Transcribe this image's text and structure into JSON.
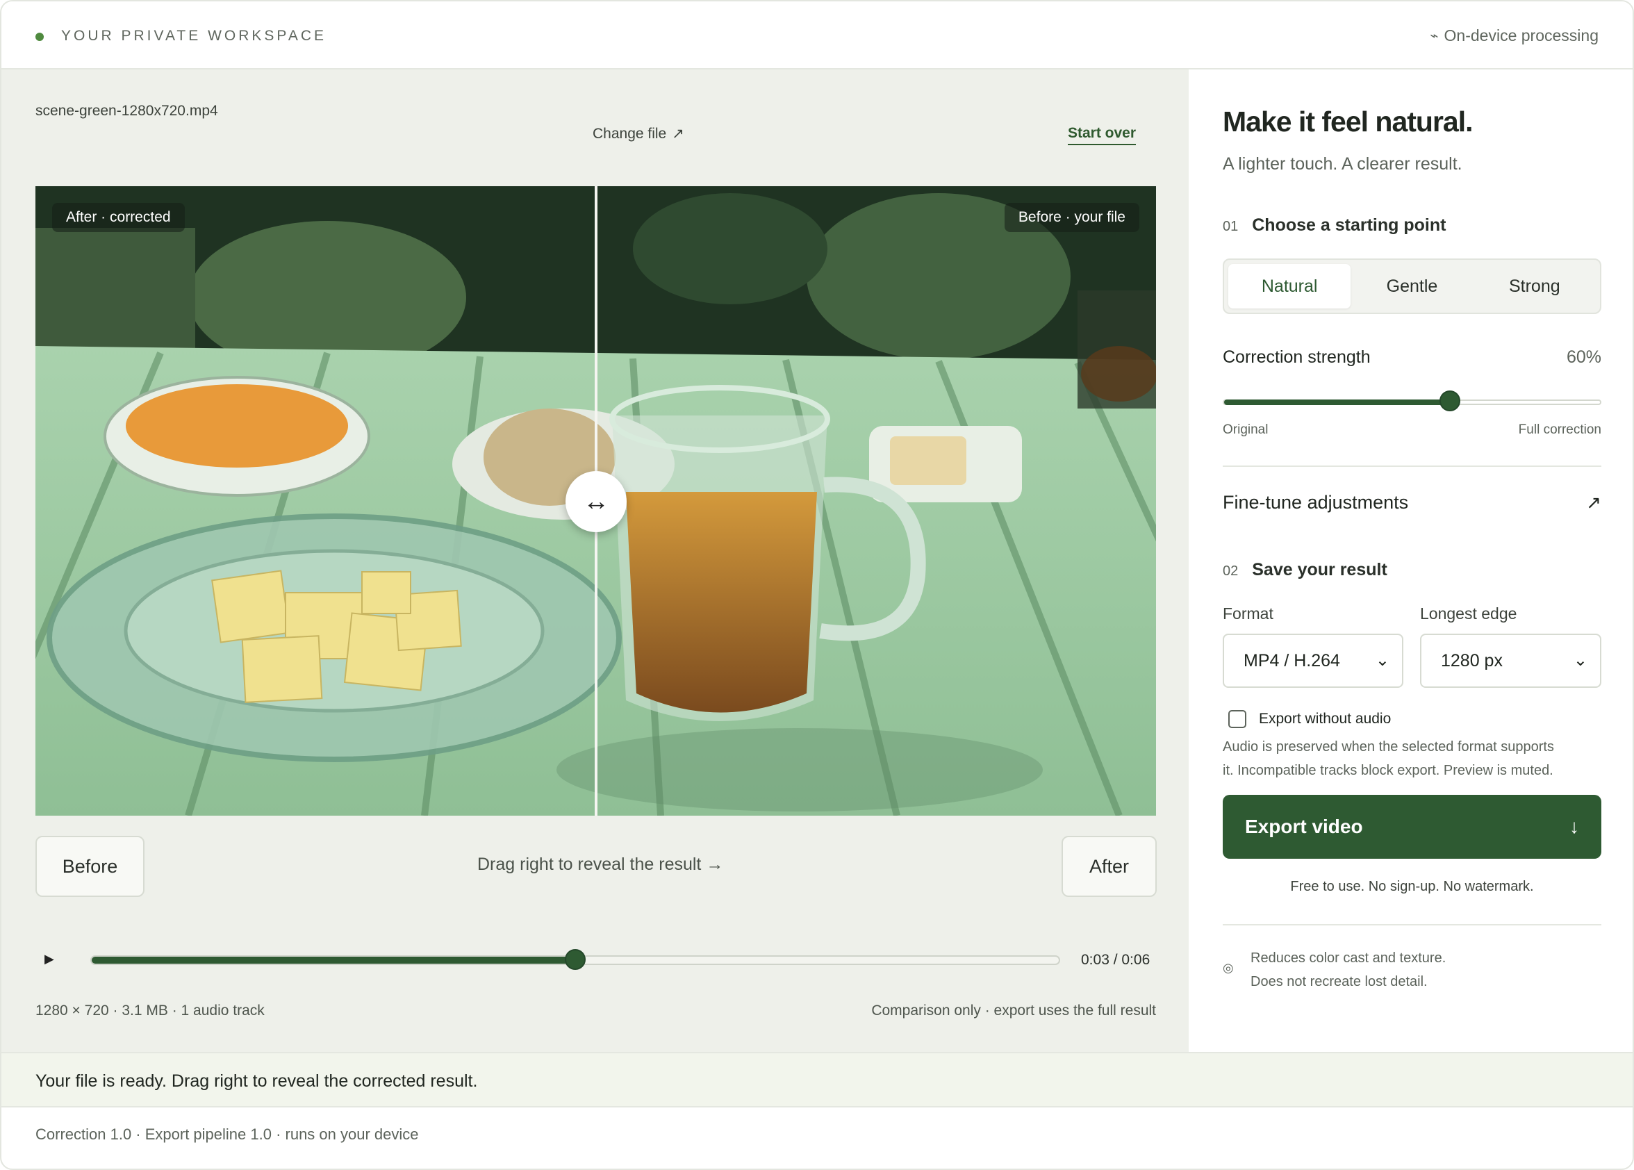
{
  "topbar": {
    "brand": "YOUR PRIVATE WORKSPACE",
    "status": "On-device processing",
    "status_icon": "spark-icon"
  },
  "file": {
    "name": "scene-green-1280x720.mp4",
    "change_label": "Change file",
    "change_arrow": "↗",
    "start_over": "Start over"
  },
  "compare": {
    "after_chip": "After · corrected",
    "before_chip": "Before · your file",
    "handle_glyph": "↔",
    "split_fraction": 0.5,
    "before_button": "Before",
    "after_button": "After",
    "drag_hint": "Drag right to reveal the result →"
  },
  "player": {
    "play_glyph": "▶",
    "timecode": "0:03 / 0:06",
    "progress": 0.5,
    "meta_left": "1280 × 720 · 3.1 MB · 1 audio track",
    "meta_right": "Comparison only · export uses the full result"
  },
  "panel": {
    "title": "Make it feel natural.",
    "subtitle": "A lighter touch. A clearer result.",
    "step1": {
      "num": "01",
      "label": "Choose a starting point"
    },
    "presets": [
      {
        "label": "Natural",
        "active": true
      },
      {
        "label": "Gentle",
        "active": false
      },
      {
        "label": "Strong",
        "active": false
      }
    ],
    "strength": {
      "label": "Correction strength",
      "value_text": "60%",
      "value": 0.6,
      "min_label": "Original",
      "max_label": "Full correction"
    },
    "finetune": {
      "label": "Fine-tune adjustments",
      "arrow": "↗"
    },
    "step2": {
      "num": "02",
      "label": "Save your result"
    },
    "format": {
      "label": "Format",
      "value": "MP4 / H.264"
    },
    "edge": {
      "label": "Longest edge",
      "value": "1280 px"
    },
    "no_audio": {
      "label": "Export without audio",
      "checked": false
    },
    "audio_note_1": "Audio is preserved when the selected format supports",
    "audio_note_2": "it. Incompatible tracks block export. Preview is muted.",
    "export_label": "Export video",
    "export_icon": "↓",
    "free_note": "Free to use. No sign-up. No watermark.",
    "disclaimer_1": "Reduces color cast and texture.",
    "disclaimer_2": "Does not recreate lost detail.",
    "disclaimer_icon": "◎"
  },
  "status": {
    "message": "Your file is ready. Drag right to reveal the corrected result."
  },
  "footer": {
    "text": "Correction 1.0 · Export pipeline 1.0 · runs on your device"
  },
  "colors": {
    "accent": "#2e5a32",
    "pane_bg": "#eef0ea",
    "status_bg": "#f2f5ec"
  }
}
